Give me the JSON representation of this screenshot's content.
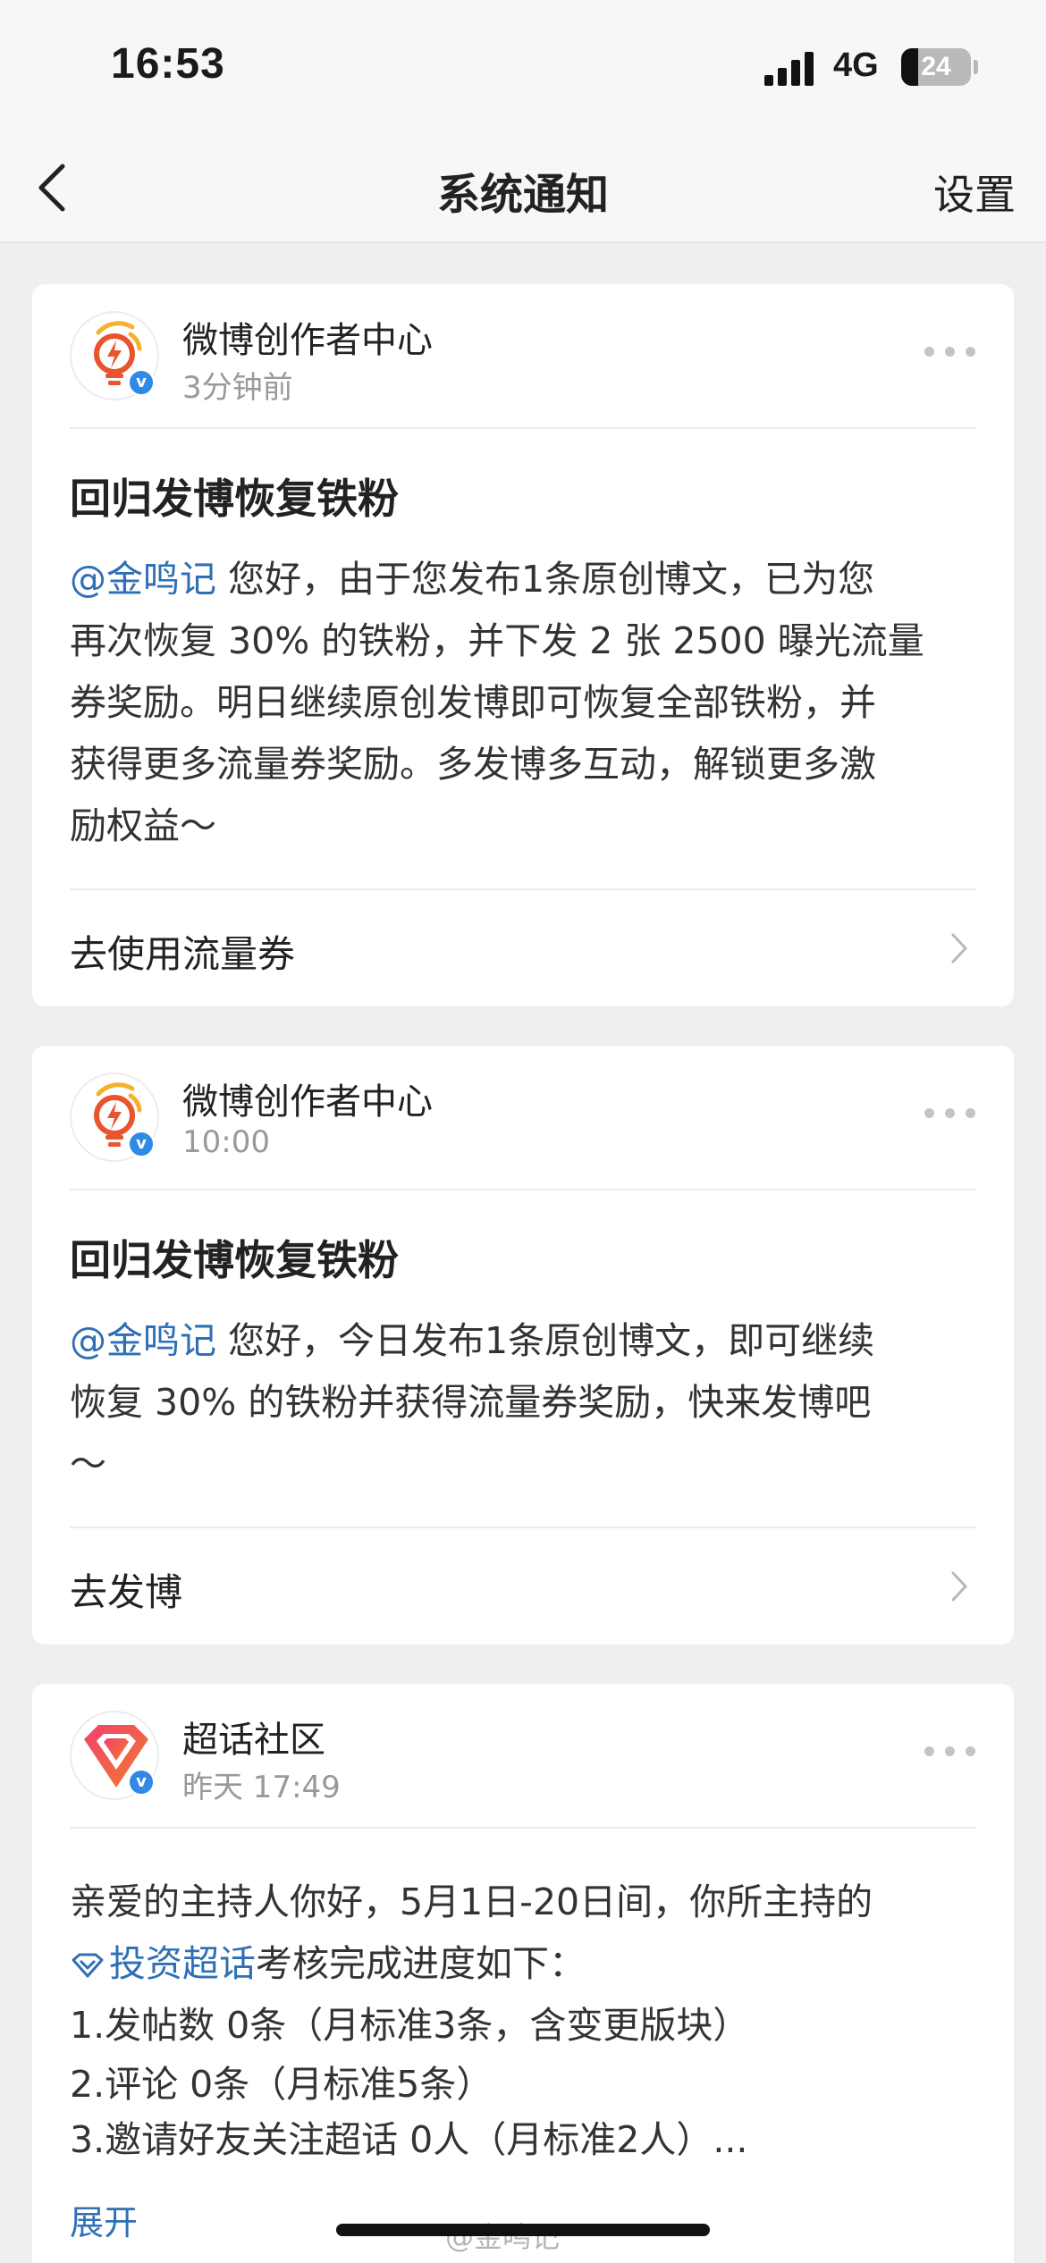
{
  "status_bar": {
    "time": "16:53",
    "network": "4G",
    "battery_level": "24",
    "battery_fraction": 0.24
  },
  "nav": {
    "title": "系统通知",
    "settings_label": "设置",
    "back_icon": "chevron-left-icon"
  },
  "notifications": [
    {
      "sender": "微博创作者中心",
      "time": "3分钟前",
      "title": "回归发博恢复铁粉",
      "mention": "@金鸣记",
      "lines": [
        " 您好，由于您发布1条原创博文，已为您",
        "再次恢复 30% 的铁粉，并下发 2 张 2500 曝光流量",
        "券奖励。明日继续原创发博即可恢复全部铁粉，并",
        "获得更多流量券奖励。多发博多互动，解锁更多激",
        "励权益～"
      ],
      "action_label": "去使用流量券"
    },
    {
      "sender": "微博创作者中心",
      "time": "10:00",
      "title": "回归发博恢复铁粉",
      "mention": "@金鸣记",
      "lines": [
        " 您好，今日发布1条原创博文，即可继续",
        "恢复 30% 的铁粉并获得流量券奖励，快来发博吧",
        "～"
      ],
      "action_label": "去发博"
    },
    {
      "sender": "超话社区",
      "time": "昨天 17:49",
      "line1": "亲爱的主持人你好，5月1日-20日间，你所主持的",
      "topic_link": "投资超话",
      "line2_rest": "考核完成进度如下：",
      "items": [
        "1.发帖数 0条（月标准3条，含变更版块）",
        "2.评论 0条（月标准5条）",
        "3.邀请好友关注超话 0人（月标准2人）..."
      ],
      "expand_label": "展开"
    }
  ],
  "colors": {
    "link": "#2f6fb5",
    "verified": "#2f8ae5",
    "background": "#efeff1"
  },
  "watermark": "@金鸣记"
}
